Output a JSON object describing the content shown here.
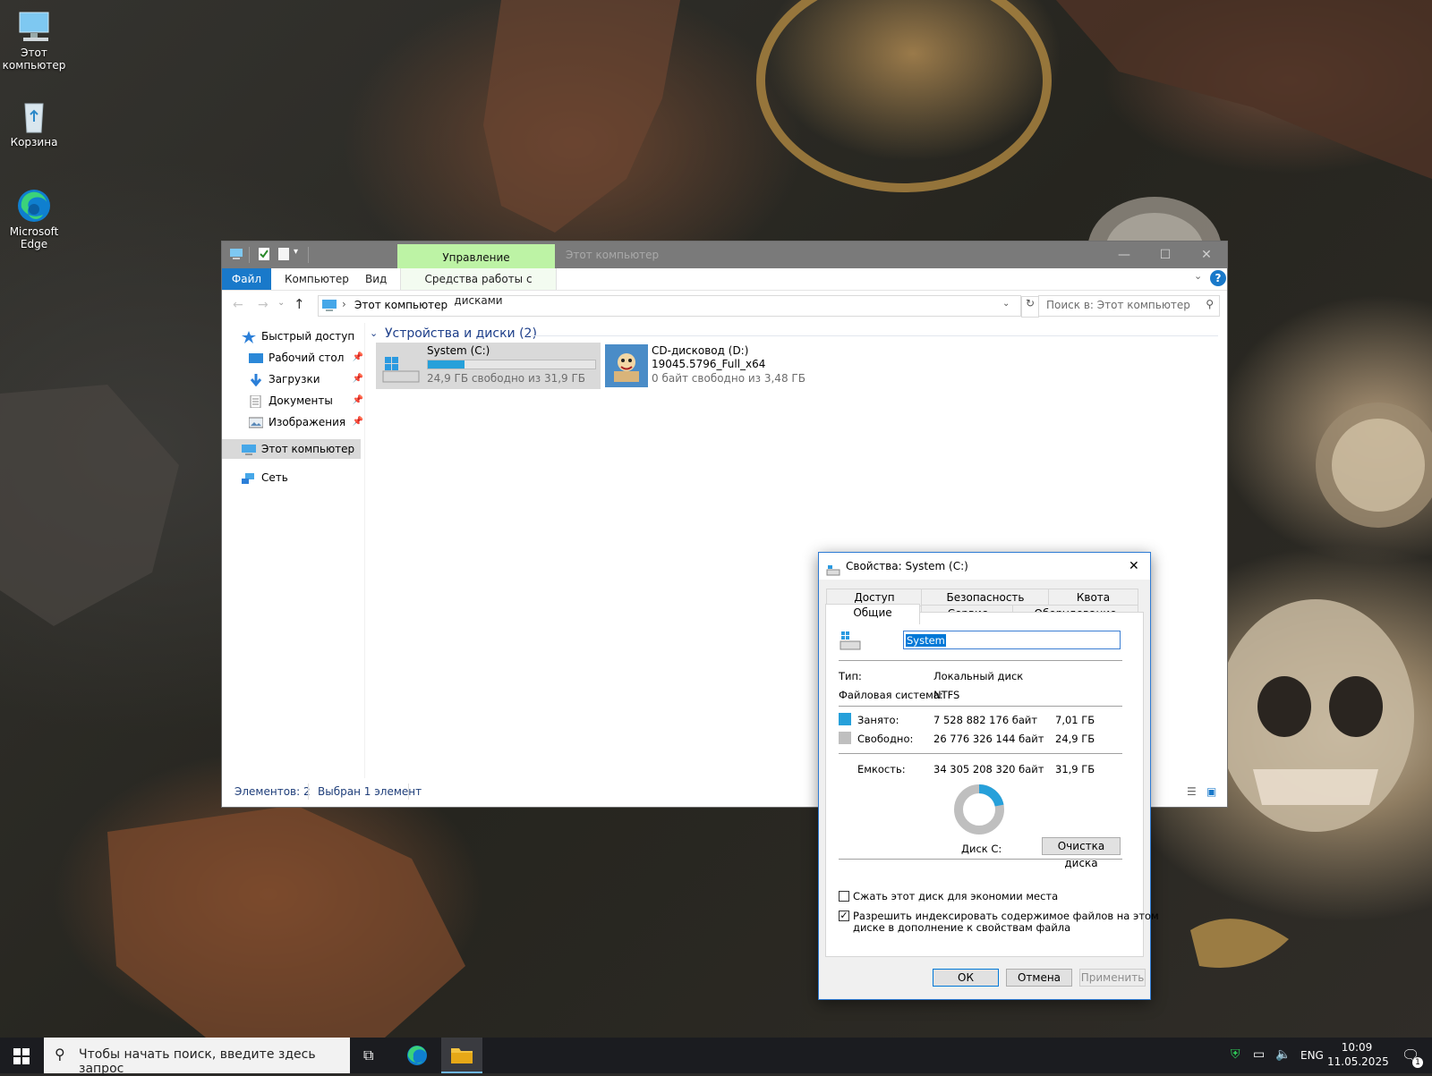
{
  "colors": {
    "accent": "#1979ca",
    "selection": "#cce8ff",
    "ribbon_manage": "#bdf3a5",
    "used": "#26a0da",
    "free": "#bfbfbf"
  },
  "desktop": {
    "icons": [
      {
        "label": "Этот компьютер",
        "icon": "this-pc-icon"
      },
      {
        "label": "Корзина",
        "icon": "recycle-bin-icon"
      },
      {
        "label": "Microsoft Edge",
        "icon": "edge-icon"
      }
    ]
  },
  "explorer": {
    "manage_tab": "Управление",
    "window_title": "Этот компьютер",
    "ribbon": {
      "file": "Файл",
      "computer": "Компьютер",
      "view": "Вид",
      "disk_tools": "Средства работы с дисками"
    },
    "address": {
      "crumb": "Этот компьютер"
    },
    "search_placeholder": "Поиск в: Этот компьютер",
    "nav": {
      "quick_access": "Быстрый доступ",
      "desktop": "Рабочий стол",
      "downloads": "Загрузки",
      "documents": "Документы",
      "pictures": "Изображения",
      "this_pc": "Этот компьютер",
      "network": "Сеть"
    },
    "group_header": "Устройства и диски (2)",
    "drives": [
      {
        "name": "System (C:)",
        "free_text": "24,9 ГБ свободно из 31,9 ГБ",
        "used_fraction": 0.22
      },
      {
        "name": "CD-дисковод (D:)",
        "label": "19045.5796_Full_x64",
        "free_text": "0 байт свободно из 3,48 ГБ"
      }
    ],
    "status": {
      "items": "Элементов: 2",
      "selected": "Выбран 1 элемент"
    }
  },
  "properties": {
    "title": "Свойства: System (C:)",
    "tabs_top": [
      "Доступ",
      "Безопасность",
      "Квота"
    ],
    "tabs_bottom": [
      "Общие",
      "Сервис",
      "Оборудование"
    ],
    "name_value": "System",
    "type_label": "Тип:",
    "type_value": "Локальный диск",
    "fs_label": "Файловая система:",
    "fs_value": "NTFS",
    "used_label": "Занято:",
    "used_bytes": "7 528 882 176 байт",
    "used_gb": "7,01 ГБ",
    "free_label": "Свободно:",
    "free_bytes": "26 776 326 144 байт",
    "free_gb": "24,9 ГБ",
    "capacity_label": "Емкость:",
    "capacity_bytes": "34 305 208 320 байт",
    "capacity_gb": "31,9 ГБ",
    "used_fraction": 0.219,
    "disk_label": "Диск C:",
    "cleanup_btn": "Очистка диска",
    "compress_label": "Сжать этот диск для экономии места",
    "compress_checked": false,
    "index_label_1": "Разрешить индексировать содержимое файлов на этом",
    "index_label_2": "диске в дополнение к свойствам файла",
    "index_checked": true,
    "ok": "ОК",
    "cancel": "Отмена",
    "apply": "Применить"
  },
  "taskbar": {
    "search_placeholder": "Чтобы начать поиск, введите здесь запрос",
    "lang": "ENG",
    "time": "10:09",
    "date": "11.05.2025",
    "notif_count": "1"
  }
}
